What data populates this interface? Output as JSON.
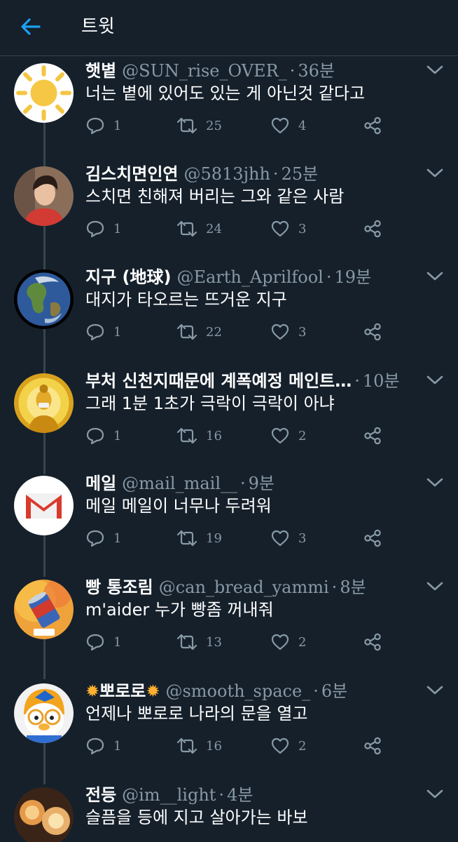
{
  "header": {
    "title": "트윗"
  },
  "tweets": [
    {
      "name": "햇볕",
      "handle": "@SUN_rise_OVER_",
      "time": "36분",
      "text": "너는 볕에 있어도 있는 게 아닌것 같다고",
      "replies": "1",
      "retweets": "25",
      "likes": "4",
      "avatar": "sun-avatar"
    },
    {
      "name": "김스치면인연",
      "handle": "@5813jhh",
      "time": "25분",
      "text": "스치면 친해져 버리는 그와 같은 사람",
      "replies": "1",
      "retweets": "24",
      "likes": "3",
      "avatar": "person-avatar"
    },
    {
      "name": "지구 (地球)",
      "handle": "@Earth_Aprilfool",
      "time": "19분",
      "text": "대지가 타오르는 뜨거운 지구",
      "replies": "1",
      "retweets": "22",
      "likes": "3",
      "avatar": "earth-avatar"
    },
    {
      "name": "부처 신천지때문에 계폭예정 메인트…",
      "handle": "",
      "time": "10분",
      "text": "그래 1분 1초가 극락이 극락이 아냐",
      "replies": "1",
      "retweets": "16",
      "likes": "2",
      "avatar": "buddha-avatar"
    },
    {
      "name": "메일",
      "handle": "@mail_mail__",
      "time": "9분",
      "text": "메일 메일이 너무나 두려워",
      "replies": "1",
      "retweets": "19",
      "likes": "3",
      "avatar": "gmail-avatar"
    },
    {
      "name": "빵 통조림",
      "handle": "@can_bread_yammi",
      "time": "8분",
      "text": "m'aider 누가 빵좀 꺼내줘",
      "replies": "1",
      "retweets": "13",
      "likes": "2",
      "avatar": "can-avatar"
    },
    {
      "name": "뽀로로",
      "handle": "@smooth_space_",
      "time": "6분",
      "text": "언제나 뽀로로 나라의 문을 열고",
      "replies": "1",
      "retweets": "16",
      "likes": "2",
      "avatar": "pororo-avatar"
    },
    {
      "name": "전등",
      "handle": "@im__light",
      "time": "4분",
      "text": "슬픔을 등에 지고 살아가는 바보",
      "replies": "",
      "retweets": "",
      "likes": "",
      "avatar": "lamp-avatar"
    }
  ]
}
